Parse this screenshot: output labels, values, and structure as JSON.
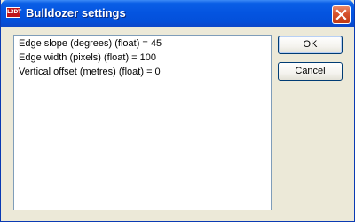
{
  "window": {
    "title": "Bulldozer settings",
    "app_icon_text": "L3DT"
  },
  "settings_list": {
    "items": [
      "Edge slope (degrees) (float) = 45",
      "Edge width (pixels) (float) = 100",
      "Vertical offset (metres) (float) = 0"
    ]
  },
  "buttons": {
    "ok_label": "OK",
    "cancel_label": "Cancel"
  },
  "colors": {
    "titlebar": "#0454e0",
    "close_button": "#d6522c",
    "dialog_background": "#ece9d8"
  }
}
